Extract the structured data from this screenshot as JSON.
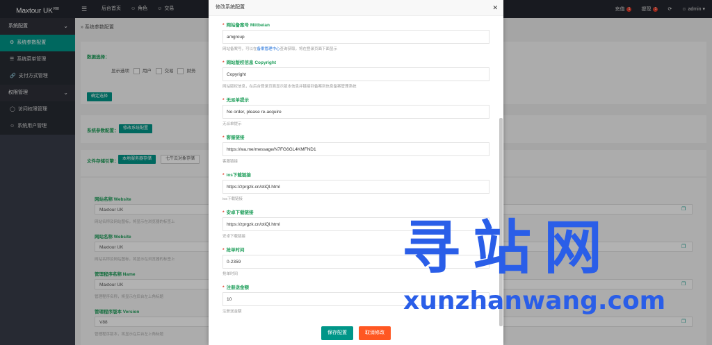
{
  "app": {
    "title": "Maxtour UK",
    "version": "V88"
  },
  "topnav": {
    "items": [
      {
        "label": "后台首页"
      },
      {
        "label": "角色",
        "icon": "user-icon"
      },
      {
        "label": "交易",
        "icon": "user-icon"
      }
    ],
    "right": {
      "recharge": "充值",
      "withdraw": "提现",
      "recharge_badge": "1",
      "withdraw_badge": "1",
      "admin": "admin"
    }
  },
  "sidebar": {
    "group1": "系统配置",
    "items1": [
      {
        "label": "系统参数配置",
        "icon": "gear-icon"
      },
      {
        "label": "系统菜单管理",
        "icon": "menu-icon"
      },
      {
        "label": "支付方式管理",
        "icon": "link-icon"
      }
    ],
    "group2": "权限管理",
    "items2": [
      {
        "label": "访问权限管理",
        "icon": "shield-icon"
      },
      {
        "label": "系统用户管理",
        "icon": "user-icon"
      }
    ]
  },
  "background": {
    "breadcrumb": "系统参数配置",
    "module_label": "数据选择：",
    "display_label": "显示选项",
    "options": [
      "用户",
      "交易",
      "财务"
    ],
    "confirm_btn": "确定选择",
    "system_label": "系统参数配置：",
    "system_btn": "修改系统配置",
    "storage_label": "文件存储引擎：",
    "storage_btn_local": "本地服务器存储",
    "storage_btn_qiniu": "七牛云对象存储",
    "site_name_label1": "网站名称 Website",
    "site_name_value1": "Maxtour UK",
    "site_name_help1": "网站名称及网站图标，将显示在浏览器的标签上",
    "site_name_label2": "网站名称 Website",
    "site_name_value2": "Maxtour UK",
    "site_name_help2": "网站名称及网站图标，将显示在浏览器的标签上",
    "app_name_label": "管理程序名称 Name",
    "app_name_value": "Maxtour UK",
    "app_name_help": "管理程序名称，将显示在后台左上角标题",
    "app_version_label": "管理程序版本 Version",
    "app_version_value": "V88",
    "app_version_help": "管理程序版本，将显示在后台左上角标题"
  },
  "modal": {
    "title": "修改系统配置",
    "fields": [
      {
        "label": "网站备案号 Miitbeian",
        "value": "amgroup",
        "help_pre": "网站备案号，可以在",
        "help_link": "备案管理中心",
        "help_post": "查询获取，将在登录页面下面显示"
      },
      {
        "label": "网站版权信息 Copyright",
        "value": "Copyright",
        "help": "网站版权信息，在后台登录页面显示版本信息并链接到备案到信息备案管理系统"
      },
      {
        "label": "无派单提示",
        "value": "No order, please re-acquire",
        "help": "无派单提示"
      },
      {
        "label": "客服链接",
        "value": "https://wa.me/message/N7FG6GL4KMFND1",
        "help": "客服链接"
      },
      {
        "label": "ios下载链接",
        "value": "https://zprgzk.cn/otiQl.html",
        "help": "ios下载链接"
      },
      {
        "label": "安卓下载链接",
        "value": "https://zprgzk.cn/otiQl.html",
        "help": "安卓下载链接"
      },
      {
        "label": "抢单时间",
        "value": "0-2359",
        "help": "抢单时间"
      },
      {
        "label": "注册送金额",
        "value": "10",
        "help": "注册送金额"
      }
    ],
    "save": "保存配置",
    "cancel": "取消修改"
  },
  "watermark": {
    "main": "寻站网",
    "sub": "xunzhanwang.com"
  },
  "colors": {
    "accent": "#009688",
    "danger": "#ff5722",
    "label_green": "#1e9e5a",
    "topbar": "#23262e",
    "sidebar": "#393d49"
  }
}
